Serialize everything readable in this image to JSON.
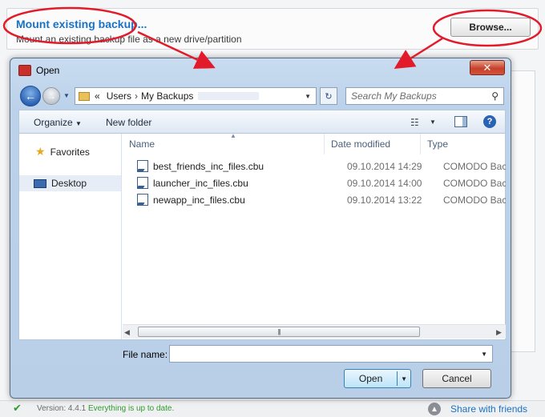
{
  "app": {
    "mount_title": "Mount existing backup...",
    "mount_description": "Mount an existing backup file as a new drive/partition",
    "browse_label": "Browse...",
    "status_version_label": "Version:",
    "status_version": "4.4.1",
    "status_message": "Everything is up to date.",
    "share_link": "Share with friends"
  },
  "dialog": {
    "title": "Open",
    "close_glyph": "✕",
    "address": {
      "prefix": "«",
      "segments": [
        "Users",
        "My Backups"
      ]
    },
    "search_placeholder": "Search My Backups",
    "toolbar": {
      "organize": "Organize",
      "new_folder": "New folder"
    },
    "nav": {
      "favorites": "Favorites",
      "desktop": "Desktop"
    },
    "columns": {
      "name": "Name",
      "date_modified": "Date modified",
      "type": "Type"
    },
    "files": [
      {
        "name": "best_friends_inc_files.cbu",
        "date": "09.10.2014 14:29",
        "type": "COMODO Backup"
      },
      {
        "name": "launcher_inc_files.cbu",
        "date": "09.10.2014 14:00",
        "type": "COMODO Backup"
      },
      {
        "name": "newapp_inc_files.cbu",
        "date": "09.10.2014 13:22",
        "type": "COMODO Backup"
      }
    ],
    "file_name_label": "File name:",
    "file_name_value": "",
    "open_label": "Open",
    "cancel_label": "Cancel"
  },
  "colors": {
    "link_blue": "#1a72c6",
    "annotation_red": "#e21b2a",
    "status_green": "#2e9b2e"
  }
}
